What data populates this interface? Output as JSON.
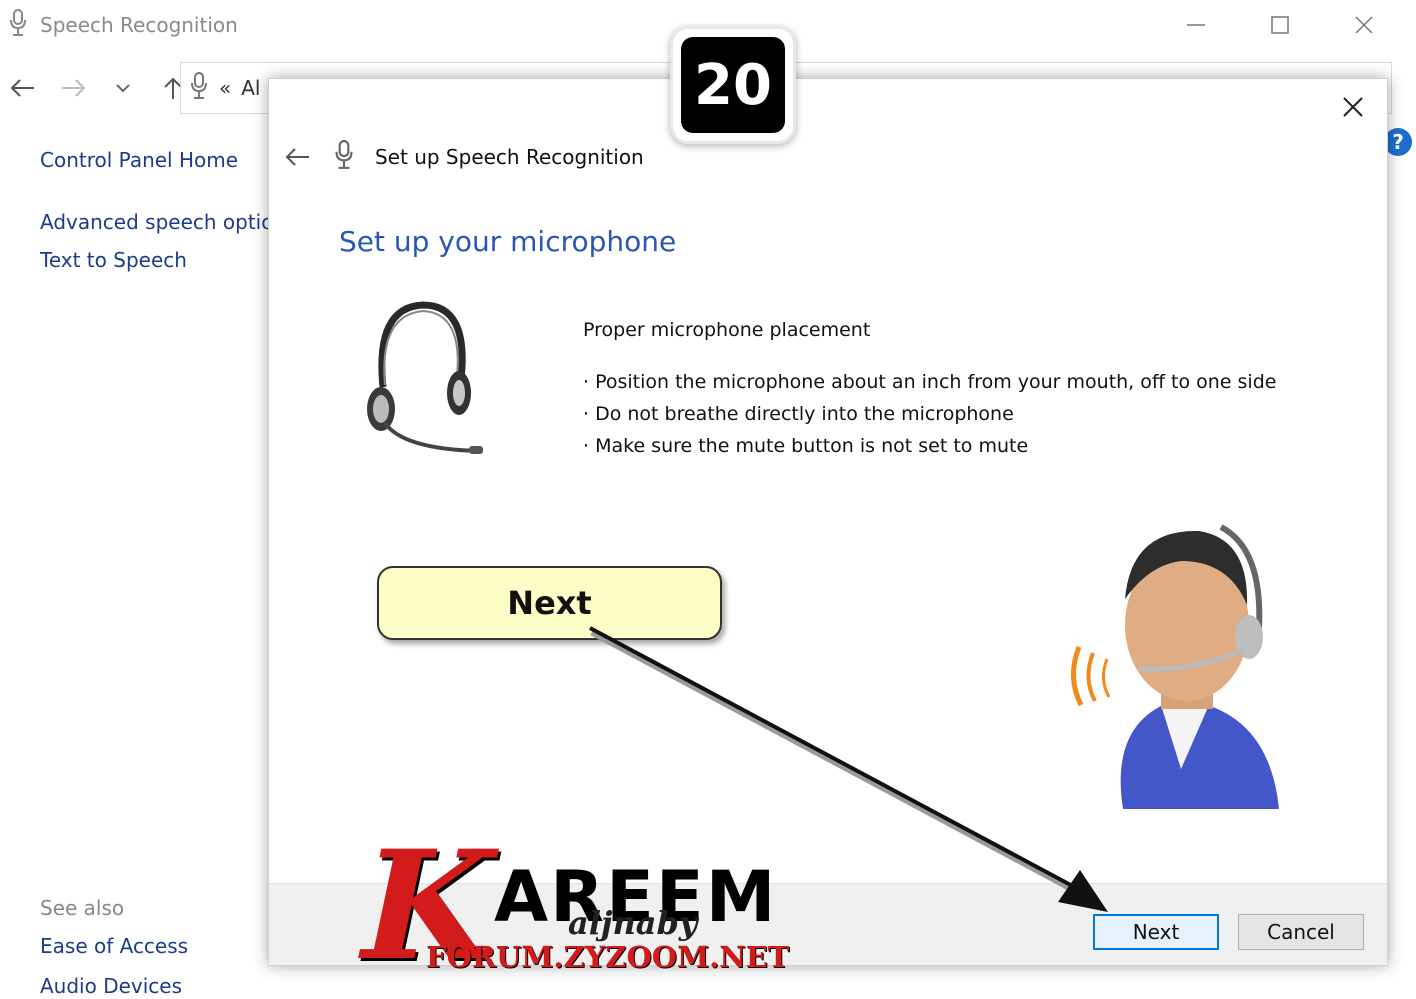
{
  "window": {
    "title": "Speech Recognition",
    "address_prefix": "«",
    "address_text": "Al"
  },
  "sidebar": {
    "items": [
      {
        "label": "Control Panel Home"
      },
      {
        "label": "Advanced speech optio"
      },
      {
        "label": "Text to Speech"
      }
    ],
    "see_also_label": "See also",
    "see_also": [
      {
        "label": "Ease of Access"
      },
      {
        "label": "Audio Devices"
      }
    ]
  },
  "dialog": {
    "header_title": "Set up Speech Recognition",
    "heading": "Set up your microphone",
    "placement_title": "Proper microphone placement",
    "bullets": [
      "· Position the microphone about an inch from your mouth, off to one side",
      "· Do not breathe directly into the microphone",
      "· Make sure the mute button is not set to mute"
    ],
    "next_label": "Next",
    "cancel_label": "Cancel"
  },
  "annotations": {
    "step_number": "20",
    "callout_label": "Next"
  },
  "watermark": {
    "brand_letter": "K",
    "brand_word": "AREEM",
    "signature": "aljnaby",
    "site": "FORUM.ZYZOOM.NET"
  },
  "help_symbol": "?",
  "colors": {
    "link": "#1d3b8a",
    "heading": "#2a56b8",
    "accent": "#0078d7",
    "callout_bg": "#fdfdc8",
    "logo_red": "#d31b1b"
  }
}
